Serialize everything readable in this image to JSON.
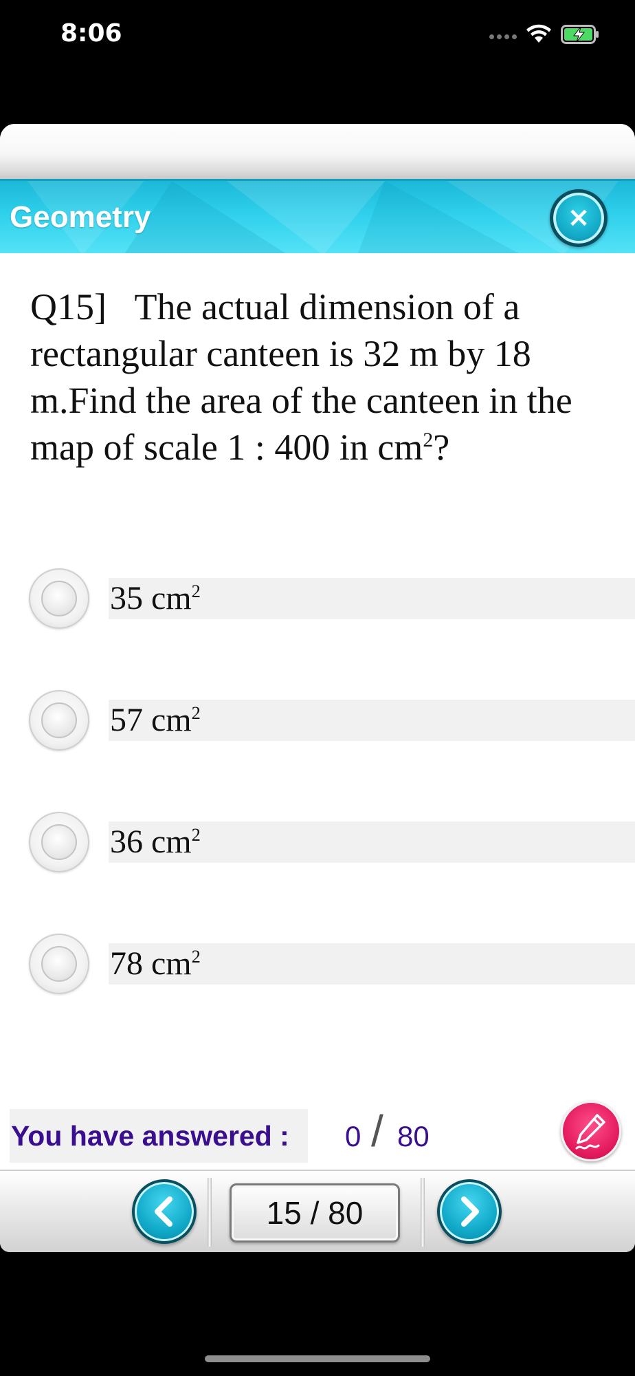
{
  "status_bar": {
    "time": "8:06"
  },
  "header": {
    "title": "Geometry",
    "close_icon": "×",
    "accent_color": "#2fd0ec"
  },
  "question": {
    "number": "Q15]",
    "text_before_sup": "The actual dimension of a rectangular canteen is 32 m by 18 m.Find the area of the canteen in the map of scale 1 : 400 in cm",
    "sup": "2",
    "text_after_sup": "?"
  },
  "options": [
    {
      "value": "35 cm",
      "sup": "2"
    },
    {
      "value": "57 cm",
      "sup": "2"
    },
    {
      "value": "36 cm",
      "sup": "2"
    },
    {
      "value": "78 cm",
      "sup": "2"
    }
  ],
  "progress": {
    "label": "You have answered :",
    "answered": "0",
    "slash": "/",
    "total": "80",
    "label_color": "#3a0f8f"
  },
  "navigation": {
    "page_indicator": "15 / 80",
    "prev_icon": "chevron-left-icon",
    "next_icon": "chevron-right-icon"
  },
  "icons": {
    "edit": "pencil-icon",
    "close": "close-icon"
  }
}
